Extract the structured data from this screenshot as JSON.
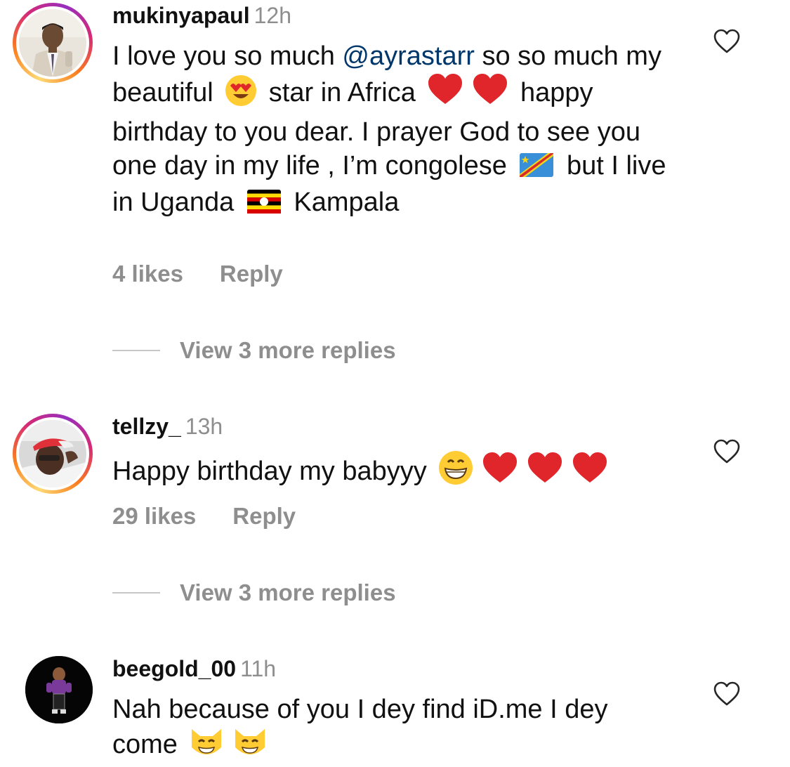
{
  "comments": [
    {
      "username": "mukinyapaul",
      "time": "12h",
      "text_parts": {
        "p1": "I love you so much ",
        "mention": "@ayrastarr",
        "p2": " so so much my beautiful ",
        "p3": " star in Africa ",
        "p4": " happy birthday to you dear. I prayer God to see you one day in my life , I’m congolese ",
        "p5": " but I live in Uganda ",
        "p6": " Kampala"
      },
      "emojis": [
        "heart-eyes-emoji",
        "red-heart-emoji",
        "red-heart-emoji",
        "congo-flag-emoji",
        "uganda-flag-emoji"
      ],
      "likes": "4 likes",
      "reply_label": "Reply",
      "view_replies": "View 3 more replies"
    },
    {
      "username": "tellzy_",
      "time": "13h",
      "text_parts": {
        "p1": "Happy birthday my babyyy "
      },
      "emojis": [
        "grinning-face-emoji",
        "red-heart-emoji",
        "red-heart-emoji",
        "red-heart-emoji"
      ],
      "likes": "29 likes",
      "reply_label": "Reply",
      "view_replies": "View 3 more replies"
    },
    {
      "username": "beegold_00",
      "time": "11h",
      "text_parts": {
        "p1": "Nah because of you I dey find iD.me I dey come "
      },
      "emojis": [
        "grinning-cat-emoji",
        "grinning-cat-emoji"
      ]
    }
  ],
  "colors": {
    "text": "#111111",
    "secondary": "#8e8e8e",
    "mention": "#00376b",
    "heart_red": "#e0252b",
    "ring_gradient": [
      "#feda75",
      "#fa7e1e",
      "#d62976",
      "#962fbf"
    ]
  }
}
